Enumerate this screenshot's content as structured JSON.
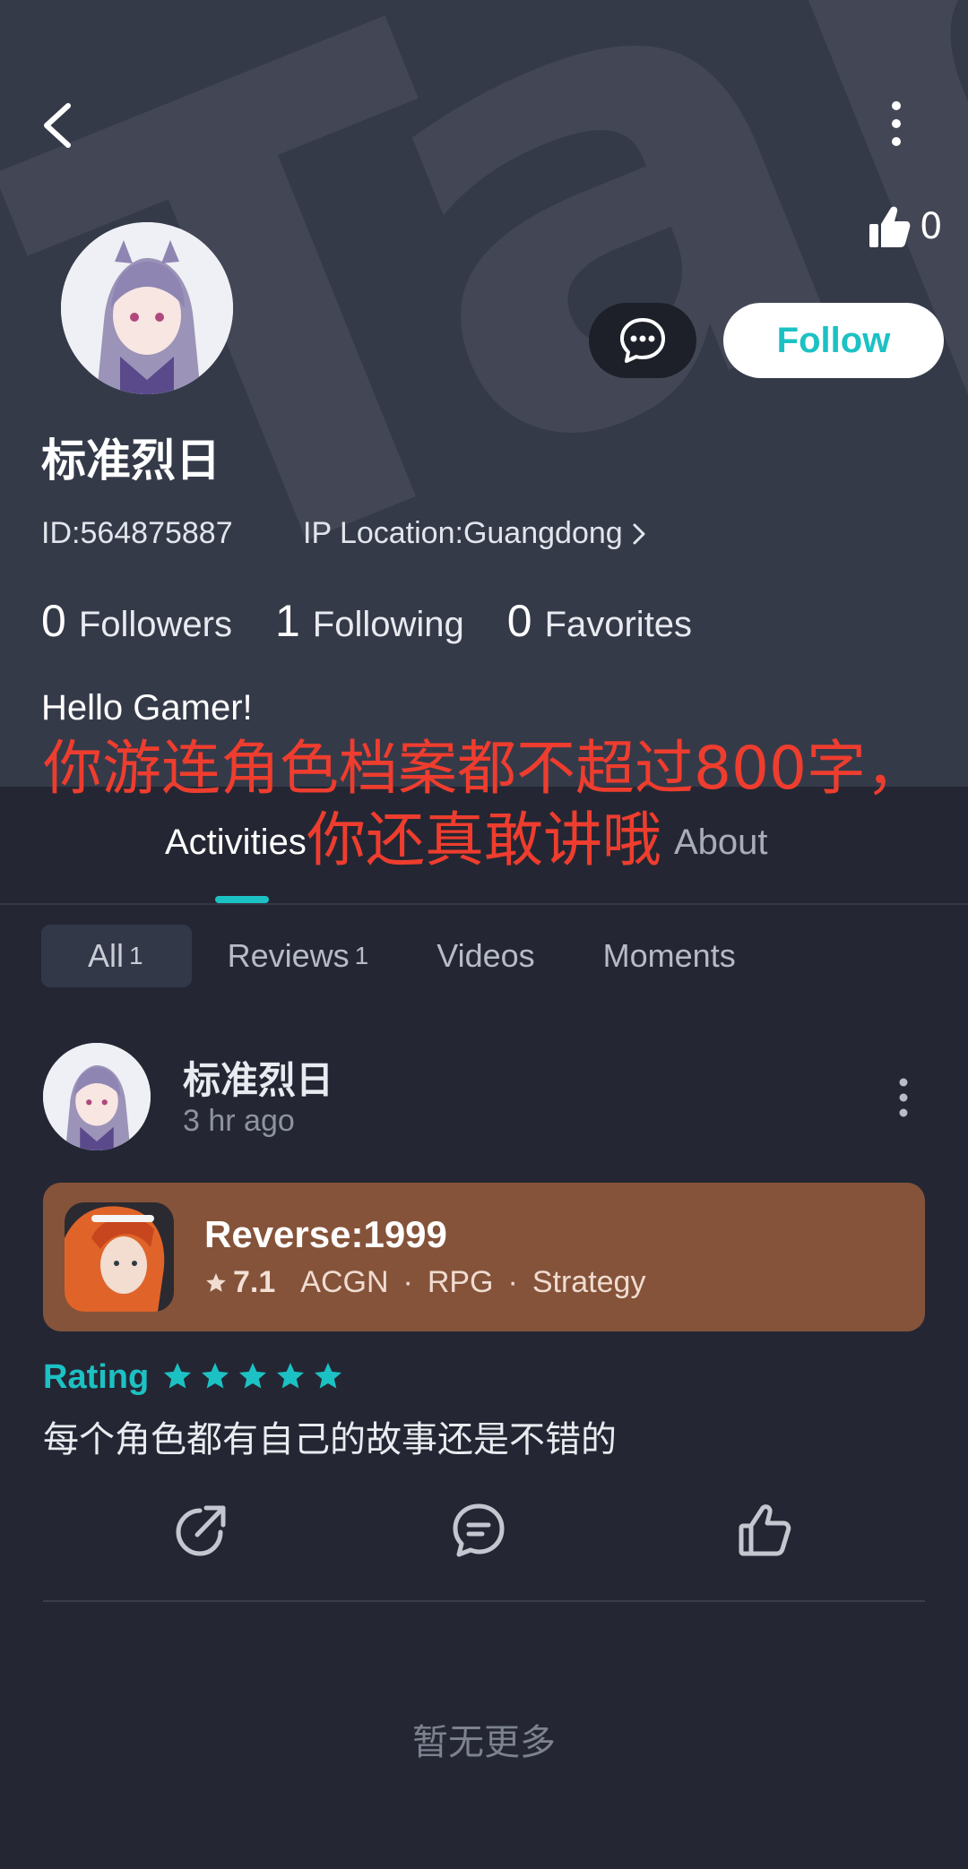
{
  "header": {
    "likes_count": "0",
    "follow_label": "Follow",
    "username": "标准烈日",
    "id_text": "ID:564875887",
    "ip_location": "IP Location:Guangdong",
    "watermark_text": "TapTap"
  },
  "stats": [
    {
      "value": "0",
      "label": "Followers"
    },
    {
      "value": "1",
      "label": "Following"
    },
    {
      "value": "0",
      "label": "Favorites"
    }
  ],
  "bio": "Hello Gamer!",
  "overlay_caption": {
    "line1": "你游连角色档案都不超过800字，",
    "line2": "你还真敢讲哦"
  },
  "tabs": [
    {
      "label": "Activities",
      "active": true
    },
    {
      "label": "About",
      "active": false
    }
  ],
  "filters": [
    {
      "label": "All",
      "count": "1",
      "active": true
    },
    {
      "label": "Reviews",
      "count": "1",
      "active": false
    },
    {
      "label": "Videos",
      "count": "",
      "active": false
    },
    {
      "label": "Moments",
      "count": "",
      "active": false
    }
  ],
  "post": {
    "author": "标准烈日",
    "time": "3 hr ago",
    "game": {
      "title": "Reverse:1999",
      "score": "7.1",
      "tags": [
        "ACGN",
        "RPG",
        "Strategy"
      ]
    },
    "rating_label": "Rating",
    "rating_stars": 5,
    "review_text": "每个角色都有自己的故事还是不错的"
  },
  "footer": {
    "no_more": "暂无更多"
  },
  "colors": {
    "accent": "#1cc1c4",
    "header_bg": "#353a49",
    "page_bg": "#242733",
    "card_bg": "#85533a",
    "overlay_red": "#ee3d2e"
  },
  "icons": [
    "back-icon",
    "more-vertical-icon",
    "thumbs-up-icon",
    "message-icon",
    "chevron-right-icon",
    "star-icon",
    "share-icon",
    "comment-icon",
    "like-icon"
  ]
}
